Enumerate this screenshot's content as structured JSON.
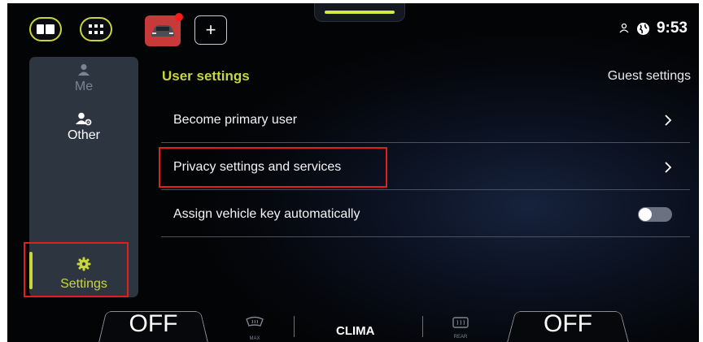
{
  "topbar": {
    "clock": "9:53"
  },
  "sidebar": {
    "items": [
      {
        "label": "Me"
      },
      {
        "label": "Other"
      },
      {
        "label": "Settings"
      }
    ]
  },
  "main": {
    "section_title": "User settings",
    "guest_settings": "Guest settings",
    "rows": [
      {
        "label": "Become primary user"
      },
      {
        "label": "Privacy settings and services"
      },
      {
        "label": "Assign vehicle key automatically",
        "toggle": "off"
      }
    ]
  },
  "bottom": {
    "left_off": "OFF",
    "right_off": "OFF",
    "clima": "CLIMA",
    "max_label": "MAX",
    "rear_label": "REAR"
  },
  "colors": {
    "accent": "#c9d63a",
    "highlight": "#e02020"
  }
}
